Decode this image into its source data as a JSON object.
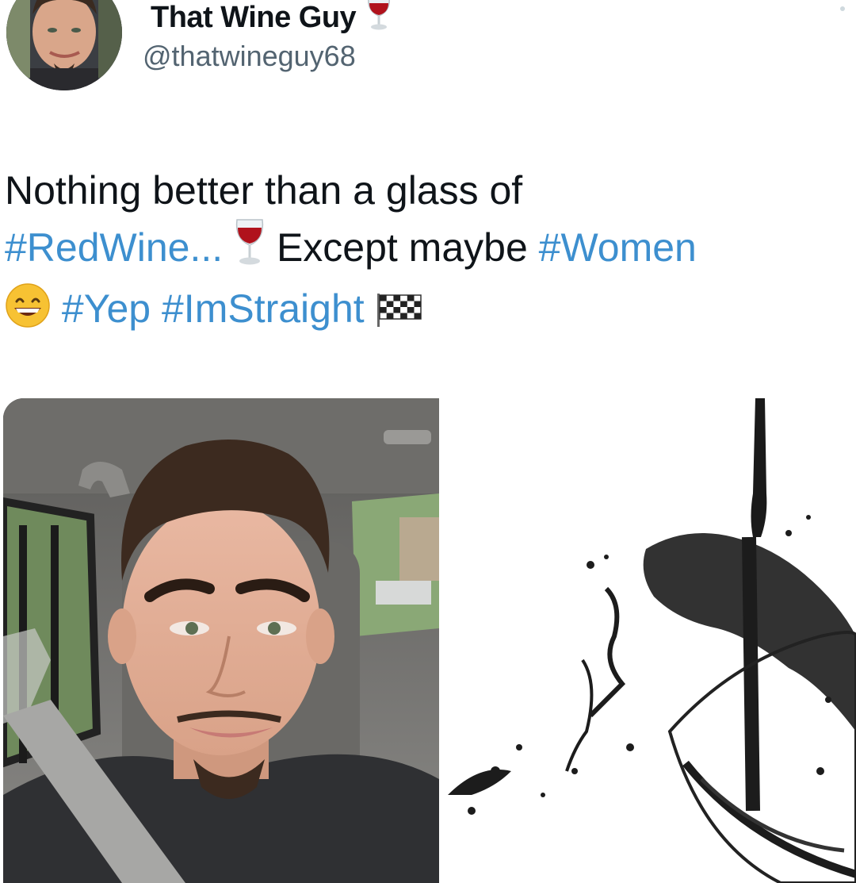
{
  "author": {
    "display_name": "That Wine Guy",
    "name_emoji": "wine-glass-icon",
    "handle": "@thatwineguy68"
  },
  "tweet": {
    "line1": "Nothing better than a glass of",
    "tag_redwine": "#RedWine...",
    "except_text": "Except maybe",
    "tag_women": "#Women",
    "tag_yep": "#Yep",
    "tag_imstraight": "#ImStraight",
    "emojis": [
      "wine-glass-icon",
      "grinning-face-icon",
      "checkered-flag-icon"
    ]
  },
  "media": {
    "photos": [
      {
        "subject": "selfie-in-car"
      },
      {
        "subject": "wine-pouring-into-glass"
      }
    ]
  },
  "colors": {
    "text": "#0f1419",
    "handle": "#536471",
    "hashtag": "#3d8fcf"
  }
}
